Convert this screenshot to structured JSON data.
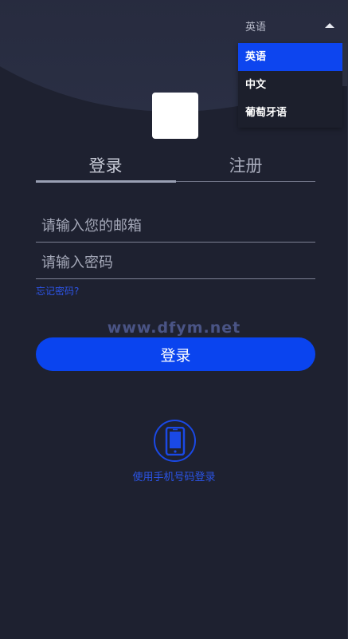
{
  "language": {
    "current": "英语",
    "options": [
      "英语",
      "中文",
      "葡萄牙语"
    ],
    "selected_index": 0
  },
  "tabs": {
    "login": "登录",
    "register": "注册"
  },
  "form": {
    "email_placeholder": "请输入您的邮箱",
    "email_value": "",
    "password_placeholder": "请输入密码",
    "password_value": "",
    "forgot_label": "忘记密码?",
    "submit_label": "登录"
  },
  "watermark": "www.dfym.net",
  "phone_login": {
    "label": "使用手机号码登录",
    "icon": "phone-icon"
  },
  "colors": {
    "background": "#1e2130",
    "accent": "#0a44ef",
    "link": "#2d55e8"
  }
}
